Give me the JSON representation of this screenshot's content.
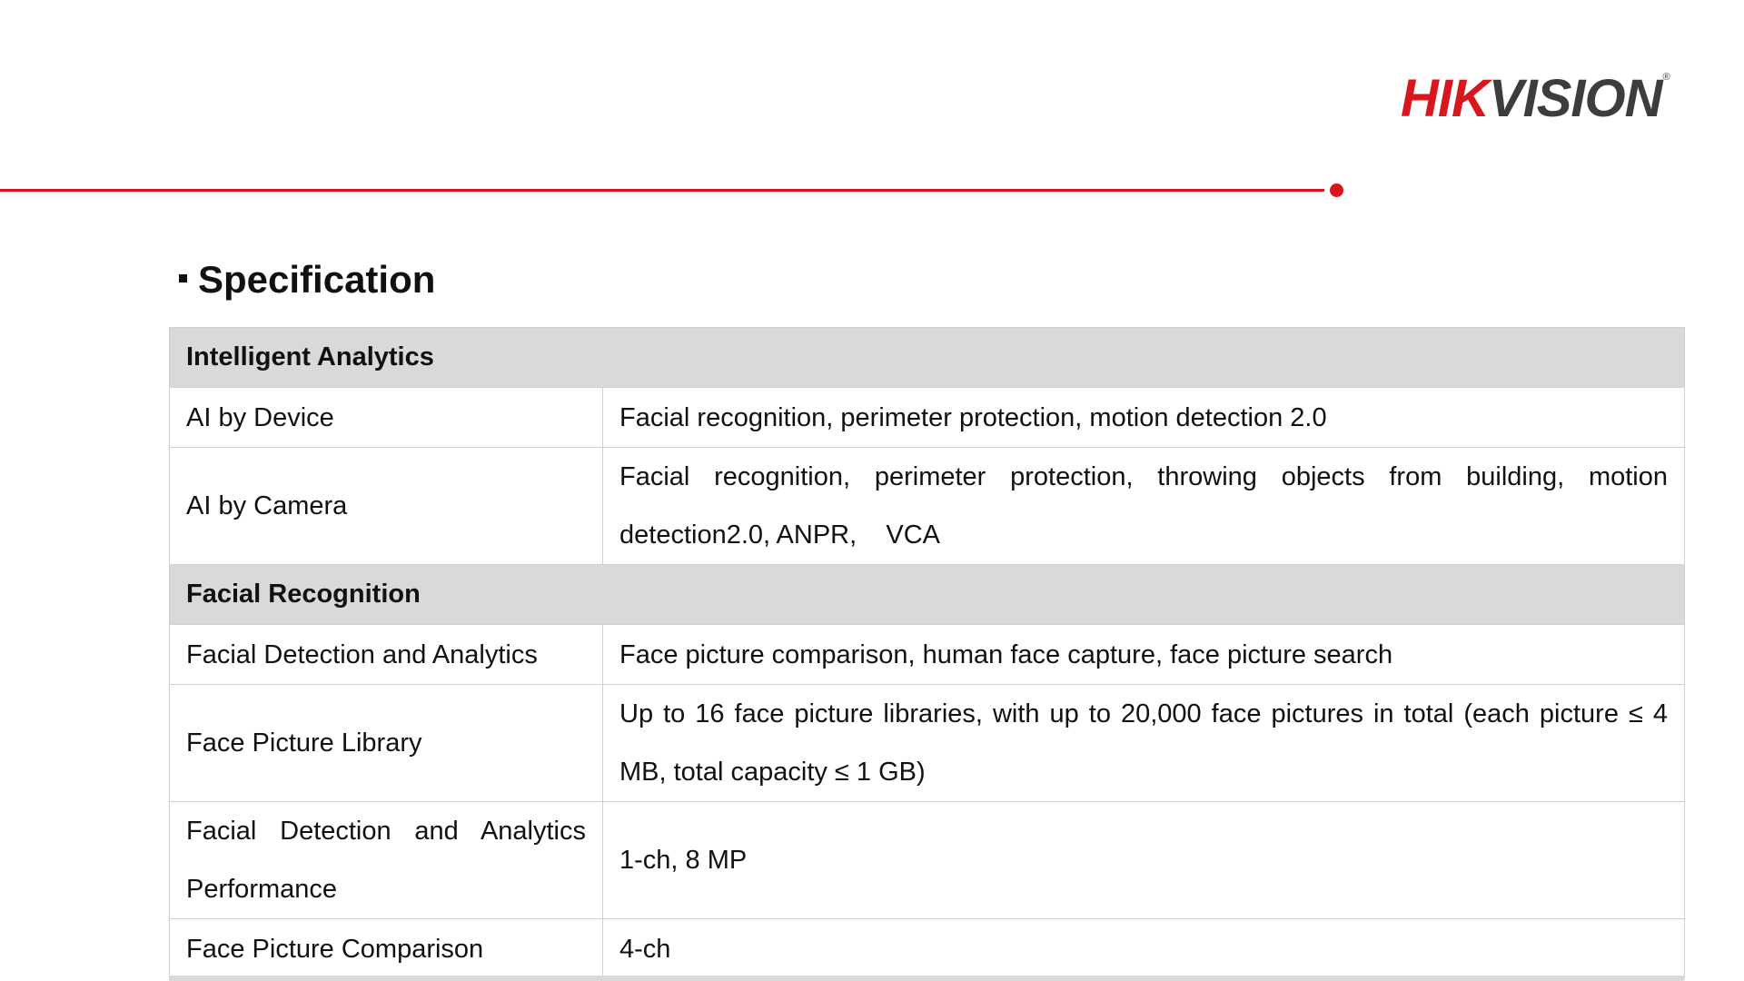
{
  "brand": {
    "logo_text_red": "HIK",
    "logo_text_gray": "VISION",
    "logo_mark": "®",
    "accent_color": "#d7161e"
  },
  "section_title": "Specification",
  "table": {
    "sections": [
      {
        "title": "Intelligent Analytics",
        "rows": [
          {
            "label": "AI by Device",
            "value": "Facial recognition, perimeter protection, motion detection 2.0"
          },
          {
            "label": "AI by Camera",
            "value": "Facial recognition, perimeter protection, throwing objects from building, motion detection2.0, ANPR,    VCA"
          }
        ]
      },
      {
        "title": "Facial Recognition",
        "rows": [
          {
            "label": "Facial Detection and Analytics",
            "value": "Face picture comparison, human face capture, face picture search"
          },
          {
            "label": "Face Picture Library",
            "value": "Up to 16 face picture libraries, with up to 20,000 face pictures in total (each picture ≤ 4 MB, total capacity ≤ 1 GB)"
          },
          {
            "label": "Facial Detection and Analytics Performance",
            "value": "1-ch, 8 MP"
          },
          {
            "label": "Face Picture Comparison",
            "value": "4-ch"
          }
        ]
      }
    ]
  }
}
